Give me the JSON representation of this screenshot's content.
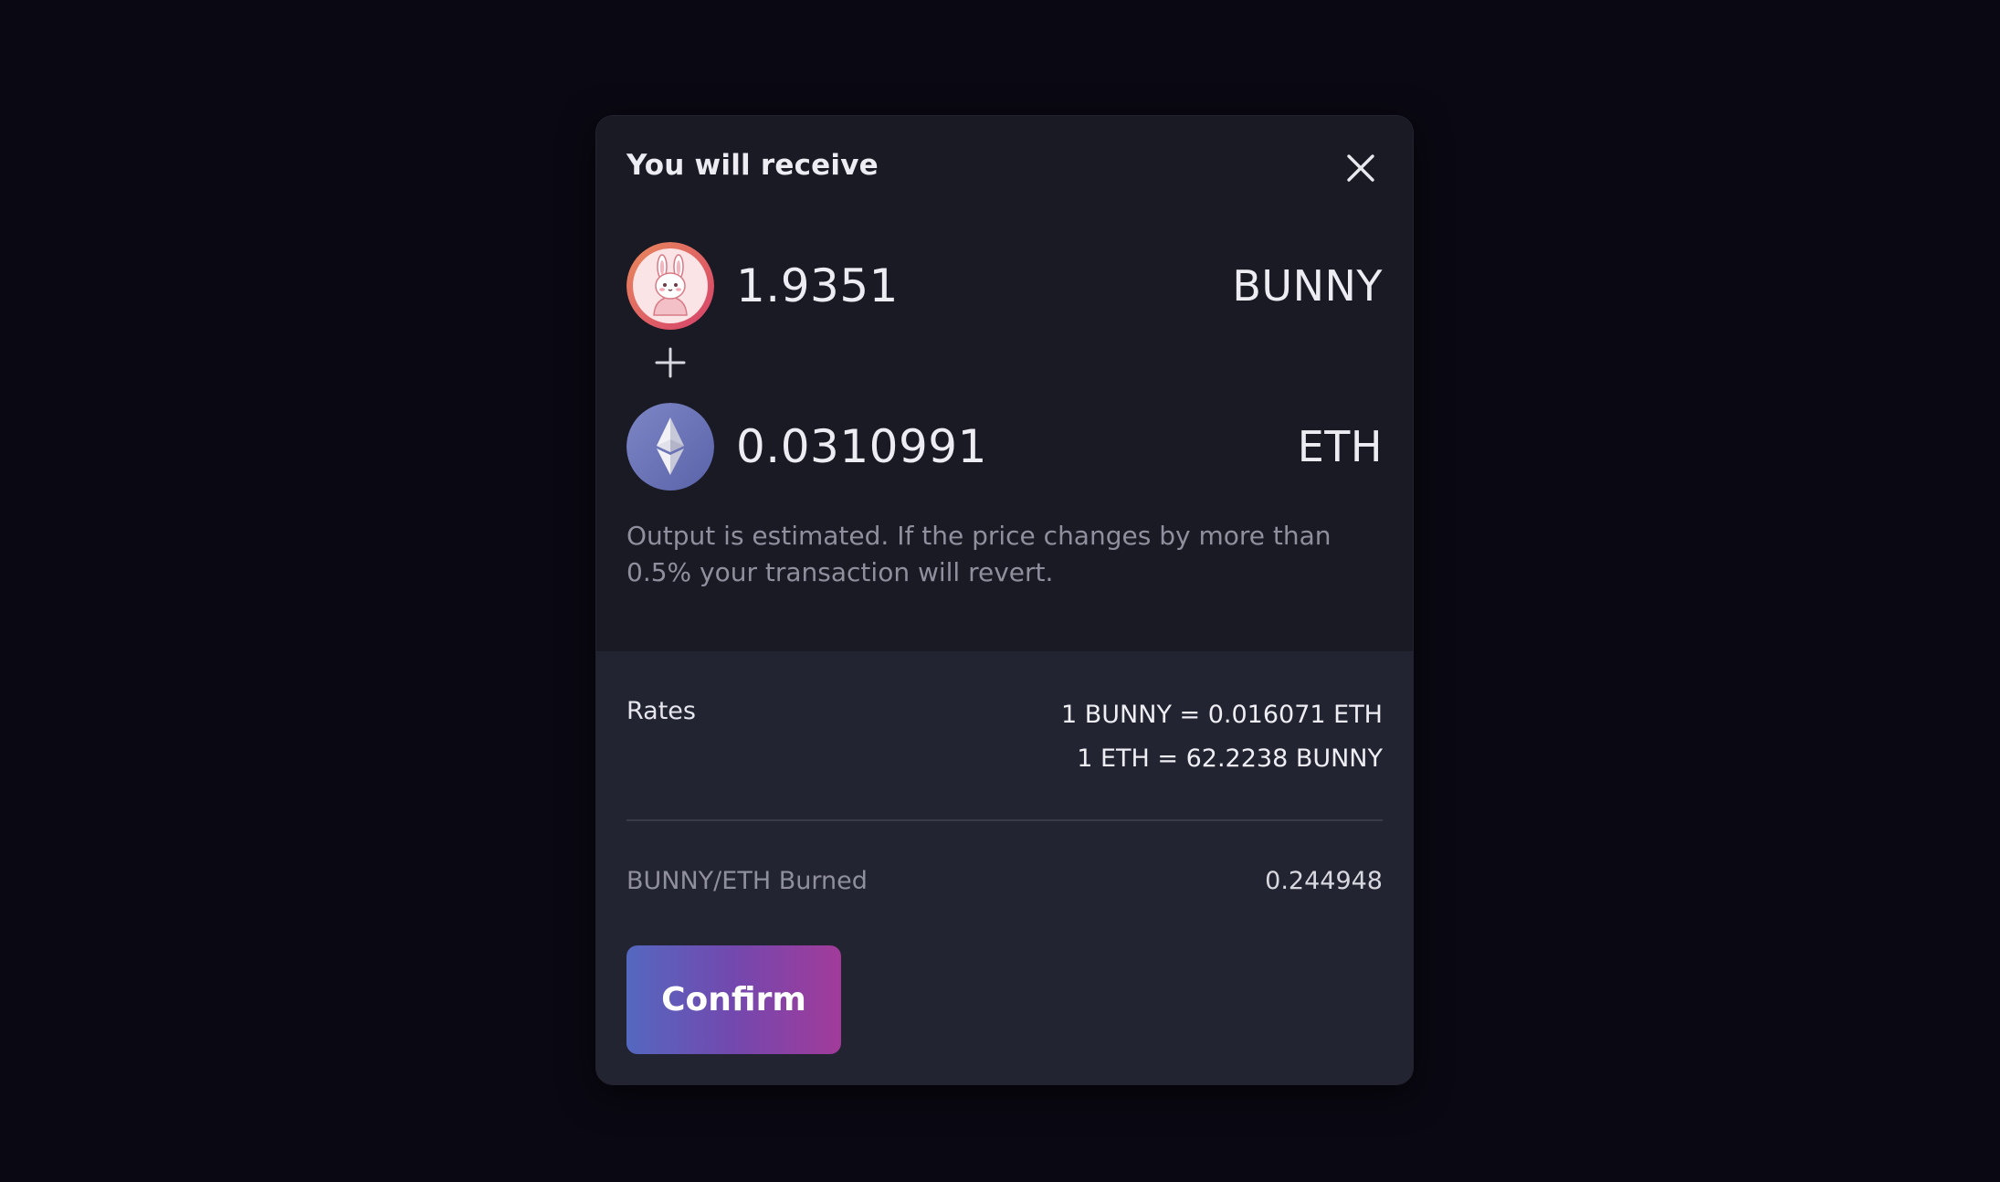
{
  "modal": {
    "title": "You will receive",
    "close_icon": "close-icon"
  },
  "tokens": [
    {
      "amount": "1.9351",
      "symbol": "BUNNY",
      "icon": "bunny-token-icon"
    },
    {
      "amount": "0.0310991",
      "symbol": "ETH",
      "icon": "eth-token-icon"
    }
  ],
  "plus_icon": "plus-icon",
  "note": "Output is estimated. If the price changes by more than 0.5% your transaction will revert.",
  "rates": {
    "label": "Rates",
    "line1": "1 BUNNY = 0.016071 ETH",
    "line2": "1 ETH = 62.2238 BUNNY"
  },
  "burned": {
    "label": "BUNNY/ETH Burned",
    "value": "0.244948"
  },
  "confirm_label": "Confirm",
  "colors": {
    "background": "#0a0812",
    "panel": "#1a1a25",
    "panel_lower": "#232431",
    "gradient_start": "#5468c0",
    "gradient_end": "#a23b9a"
  }
}
